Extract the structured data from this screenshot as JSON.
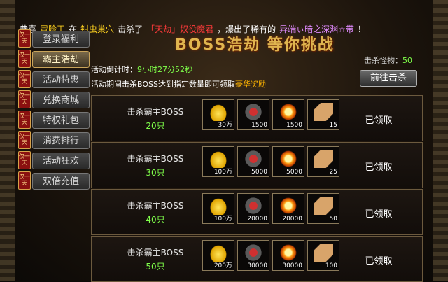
{
  "marquee": [
    {
      "text": "恭喜",
      "color": "white"
    },
    {
      "text": "冒险王",
      "color": "yellow"
    },
    {
      "text": "在",
      "color": "white"
    },
    {
      "text": "钳虫巢穴",
      "color": "yellow"
    },
    {
      "text": "击杀了",
      "color": "white"
    },
    {
      "text": "「天劫」奴役魔君",
      "color": "red"
    },
    {
      "text": "，爆出了稀有的",
      "color": "white"
    },
    {
      "text": "异端ぃ暗之深渊☆带",
      "color": "purple"
    },
    {
      "text": "！",
      "color": "white"
    }
  ],
  "sidebar": {
    "tag": "仅一天",
    "items": [
      {
        "label": "登录福利",
        "active": false
      },
      {
        "label": "霸主浩劫",
        "active": true
      },
      {
        "label": "活动特惠",
        "active": false
      },
      {
        "label": "兑换商城",
        "active": false
      },
      {
        "label": "特权礼包",
        "active": false
      },
      {
        "label": "消费排行",
        "active": false
      },
      {
        "label": "活动狂欢",
        "active": false
      },
      {
        "label": "双倍充值",
        "active": false
      }
    ]
  },
  "banner": "BOSS浩劫 等你挑战",
  "kills": {
    "label": "击杀怪物：",
    "value": "50"
  },
  "countdown": {
    "label": "活动倒计时：",
    "value": "9小时27分52秒"
  },
  "info": {
    "text": "活动期间击杀BOSS达到指定数量即可领取",
    "highlight": "豪华奖励"
  },
  "go_button": "前往击杀",
  "rows": [
    {
      "task": "击杀霸主BOSS",
      "count": "20只",
      "rewards": [
        "30万",
        "1500",
        "1500",
        "15"
      ],
      "status": "已领取"
    },
    {
      "task": "击杀霸主BOSS",
      "count": "30只",
      "rewards": [
        "100万",
        "5000",
        "5000",
        "25"
      ],
      "status": "已领取"
    },
    {
      "task": "击杀霸主BOSS",
      "count": "40只",
      "rewards": [
        "100万",
        "20000",
        "20000",
        "50"
      ],
      "status": "已领取"
    },
    {
      "task": "击杀霸主BOSS",
      "count": "50只",
      "rewards": [
        "200万",
        "30000",
        "30000",
        "100"
      ],
      "status": "已领取"
    }
  ],
  "reward_icons": [
    "gold-ingot-icon",
    "medal-icon",
    "gem-icon",
    "scroll-icon"
  ],
  "colors": {
    "accent_green": "#7fff4a",
    "accent_gold": "#ffb400",
    "alert_red": "#ff3a3a"
  }
}
